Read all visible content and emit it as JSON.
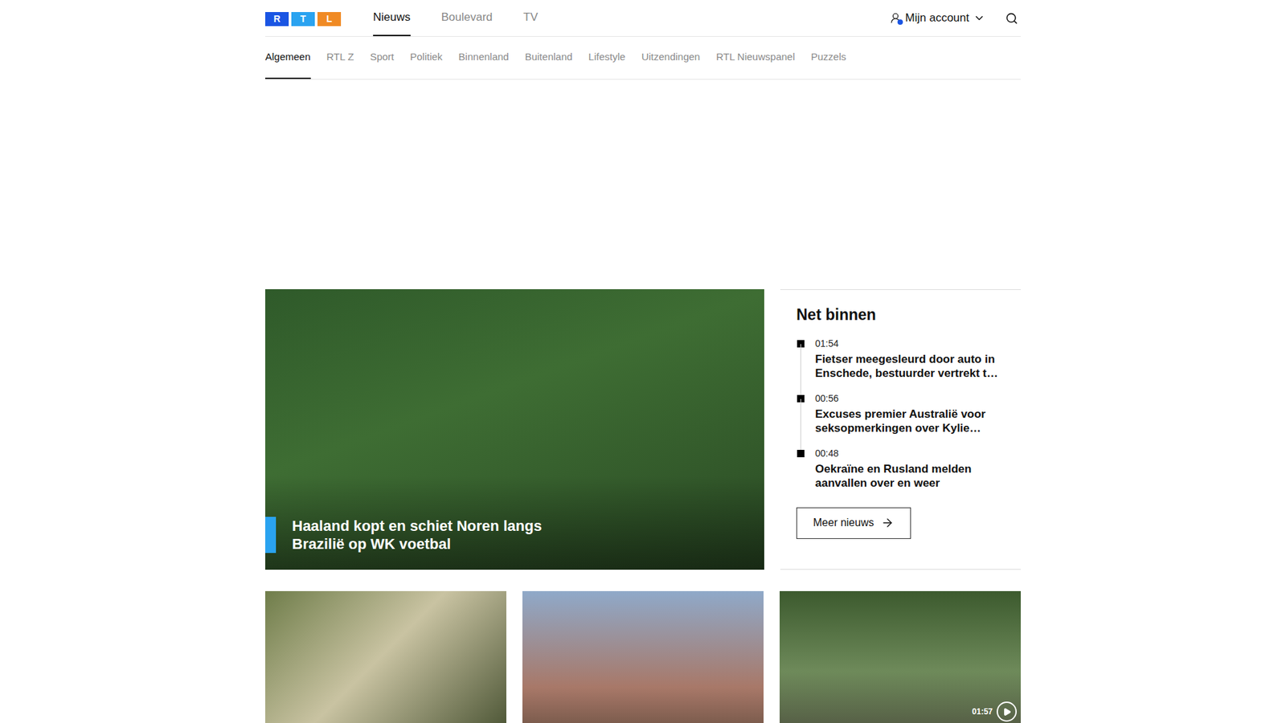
{
  "logo": {
    "letters": [
      "R",
      "T",
      "L"
    ]
  },
  "main_nav": [
    {
      "label": "Nieuws",
      "selected": true
    },
    {
      "label": "Boulevard",
      "selected": false
    },
    {
      "label": "TV",
      "selected": false
    }
  ],
  "account": {
    "label": "Mijn account"
  },
  "sub_nav": [
    {
      "label": "Algemeen",
      "selected": true
    },
    {
      "label": "RTL Z",
      "selected": false
    },
    {
      "label": "Sport",
      "selected": false
    },
    {
      "label": "Politiek",
      "selected": false
    },
    {
      "label": "Binnenland",
      "selected": false
    },
    {
      "label": "Buitenland",
      "selected": false
    },
    {
      "label": "Lifestyle",
      "selected": false
    },
    {
      "label": "Uitzendingen",
      "selected": false
    },
    {
      "label": "RTL Nieuwspanel",
      "selected": false
    },
    {
      "label": "Puzzels",
      "selected": false
    }
  ],
  "hero": {
    "title": "Haaland kopt en schiet Noren langs Brazilië op WK voetbal"
  },
  "net_binnen": {
    "title": "Net binnen",
    "items": [
      {
        "time": "01:54",
        "headline": "Fietser meegesleurd door auto in Enschede, bestuurder vertrekt t…"
      },
      {
        "time": "00:56",
        "headline": "Excuses premier Australië voor seksopmerkingen over Kylie…"
      },
      {
        "time": "00:48",
        "headline": "Oekraïne en Rusland melden aanvallen over en weer"
      }
    ],
    "button": "Meer nieuws"
  },
  "cards": [
    {
      "video": false,
      "duration": ""
    },
    {
      "video": false,
      "duration": ""
    },
    {
      "video": true,
      "duration": "01:57"
    }
  ]
}
